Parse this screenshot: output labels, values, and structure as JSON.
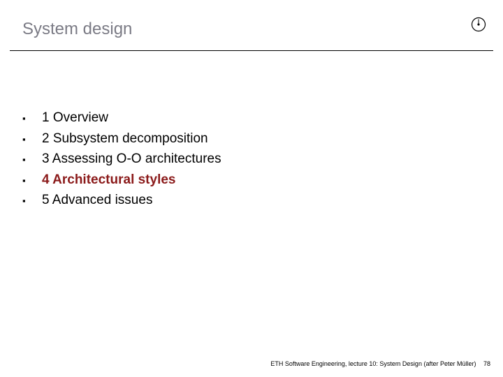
{
  "title": "System design",
  "bullet_glyph": "▪",
  "items": [
    {
      "text": "1 Overview",
      "highlight": false
    },
    {
      "text": "2 Subsystem decomposition",
      "highlight": false
    },
    {
      "text": "3 Assessing O-O architectures",
      "highlight": false
    },
    {
      "text": "4 Architectural styles",
      "highlight": true
    },
    {
      "text": "5 Advanced issues",
      "highlight": false
    }
  ],
  "footer": {
    "text": "ETH Software Engineering, lecture 10: System Design (after Peter Müller)",
    "page": "78"
  }
}
